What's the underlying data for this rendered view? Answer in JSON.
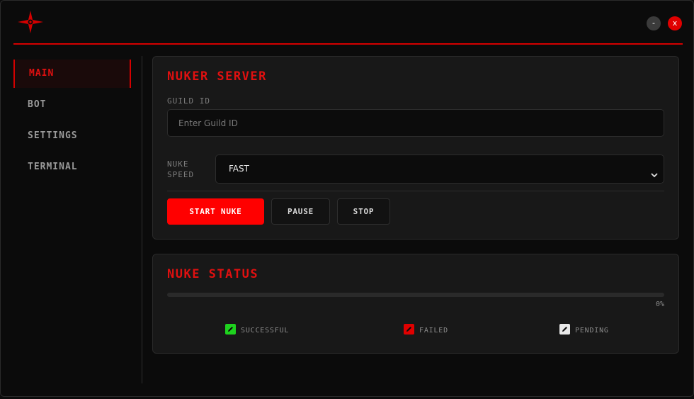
{
  "window": {
    "minimize_label": "-",
    "close_label": "x",
    "accent_color": "#e00000"
  },
  "sidebar": {
    "items": [
      {
        "label": "MAIN",
        "active": true
      },
      {
        "label": "BOT",
        "active": false
      },
      {
        "label": "SETTINGS",
        "active": false
      },
      {
        "label": "TERMINAL",
        "active": false
      }
    ]
  },
  "server": {
    "title": "NUKER SERVER",
    "guild_label": "GUILD ID",
    "guild_placeholder": "Enter Guild ID",
    "guild_value": "",
    "speed_label_line1": "NUKE",
    "speed_label_line2": "SPEED",
    "speed_value": "FAST",
    "buttons": {
      "start": "START NUKE",
      "pause": "PAUSE",
      "stop": "STOP"
    }
  },
  "status": {
    "title": "NUKE STATUS",
    "progress_text": "0%",
    "progress_fraction": 0,
    "legend": [
      {
        "label": "SUCCESSFUL",
        "color": "#1ed21e"
      },
      {
        "label": "FAILED",
        "color": "#e00000"
      },
      {
        "label": "PENDING",
        "color": "#e8e8e8"
      }
    ]
  },
  "icons": {
    "logo": "star-logo-icon",
    "select_arrow": "chevron-down-icon",
    "legend": "edit-icon"
  }
}
